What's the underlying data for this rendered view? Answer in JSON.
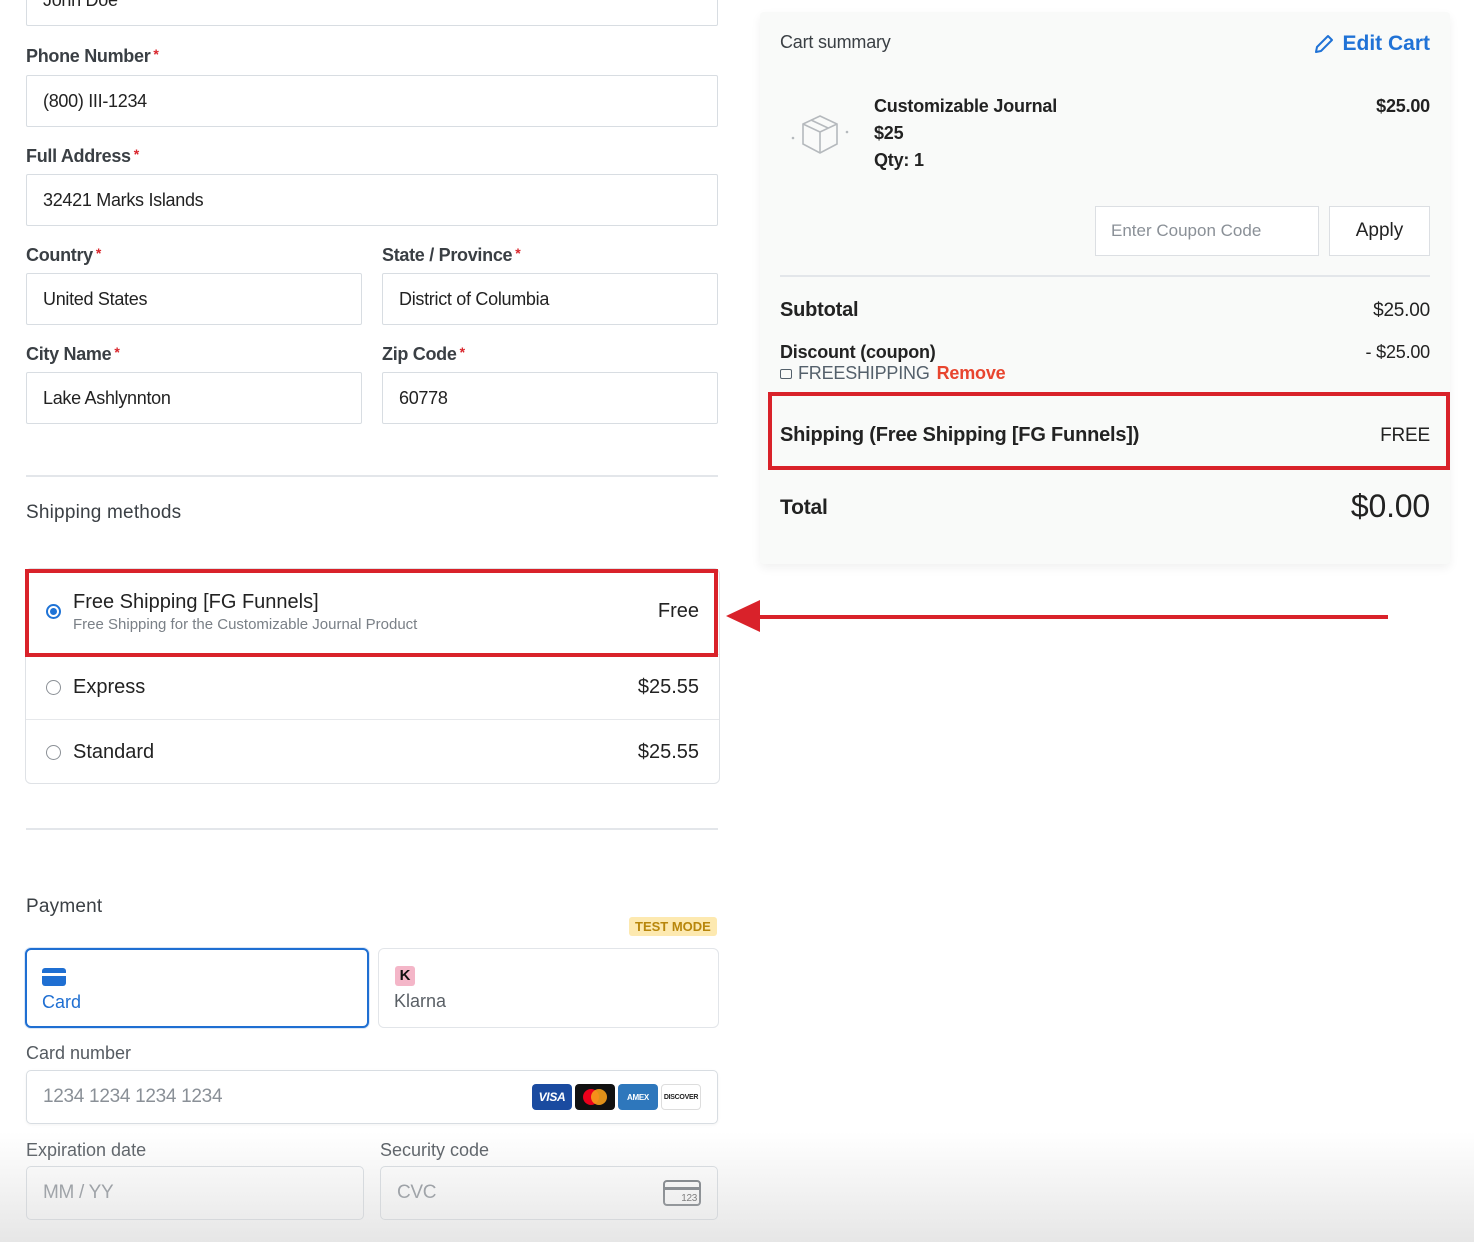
{
  "form": {
    "name_value": "John Doe",
    "phone": {
      "label": "Phone Number",
      "required": "*",
      "value": "(800) III-1234"
    },
    "address": {
      "label": "Full Address",
      "required": "*",
      "value": "32421 Marks Islands"
    },
    "country": {
      "label": "Country",
      "required": "*",
      "value": "United States"
    },
    "state": {
      "label": "State / Province",
      "required": "*",
      "value": "District of Columbia"
    },
    "city": {
      "label": "City Name",
      "required": "*",
      "value": "Lake Ashlynnton"
    },
    "zip": {
      "label": "Zip Code",
      "required": "*",
      "value": "60778"
    }
  },
  "shipping": {
    "title": "Shipping methods",
    "methods": [
      {
        "name": "Free Shipping [FG Funnels]",
        "description": "Free Shipping for the Customizable Journal Product",
        "price": "Free",
        "selected": true
      },
      {
        "name": "Express",
        "price": "$25.55",
        "selected": false
      },
      {
        "name": "Standard",
        "price": "$25.55",
        "selected": false
      }
    ]
  },
  "payment": {
    "title": "Payment",
    "test_mode": "TEST MODE",
    "tabs": [
      {
        "label": "Card",
        "icon": "credit-card-icon",
        "active": true
      },
      {
        "label": "Klarna",
        "icon": "klarna-icon",
        "icon_text": "K",
        "active": false
      }
    ],
    "card_number": {
      "label": "Card number",
      "placeholder": "1234 1234 1234 1234"
    },
    "card_brands": [
      "VISA",
      "mastercard",
      "AMEX",
      "DISCOVER"
    ],
    "expiry": {
      "label": "Expiration date",
      "placeholder": "MM / YY"
    },
    "security": {
      "label": "Security code",
      "placeholder": "CVC",
      "icon_text": "123"
    }
  },
  "cart": {
    "title": "Cart summary",
    "edit_label": "Edit Cart",
    "item": {
      "name": "Customizable Journal",
      "price": "$25",
      "qty": "Qty: 1",
      "line_total": "$25.00"
    },
    "coupon_placeholder": "Enter Coupon Code",
    "apply_label": "Apply",
    "subtotal_label": "Subtotal",
    "subtotal_value": "$25.00",
    "discount_label": "Discount (coupon)",
    "discount_value": "- $25.00",
    "coupon_code": "FREESHIPPING",
    "remove_label": "Remove",
    "shipping_label": "Shipping (Free Shipping [FG Funnels])",
    "shipping_value": "FREE",
    "total_label": "Total",
    "total_value": "$0.00"
  },
  "colors": {
    "accent": "#1f73d6",
    "annotation": "#d9222a",
    "remove": "#e8452f"
  }
}
